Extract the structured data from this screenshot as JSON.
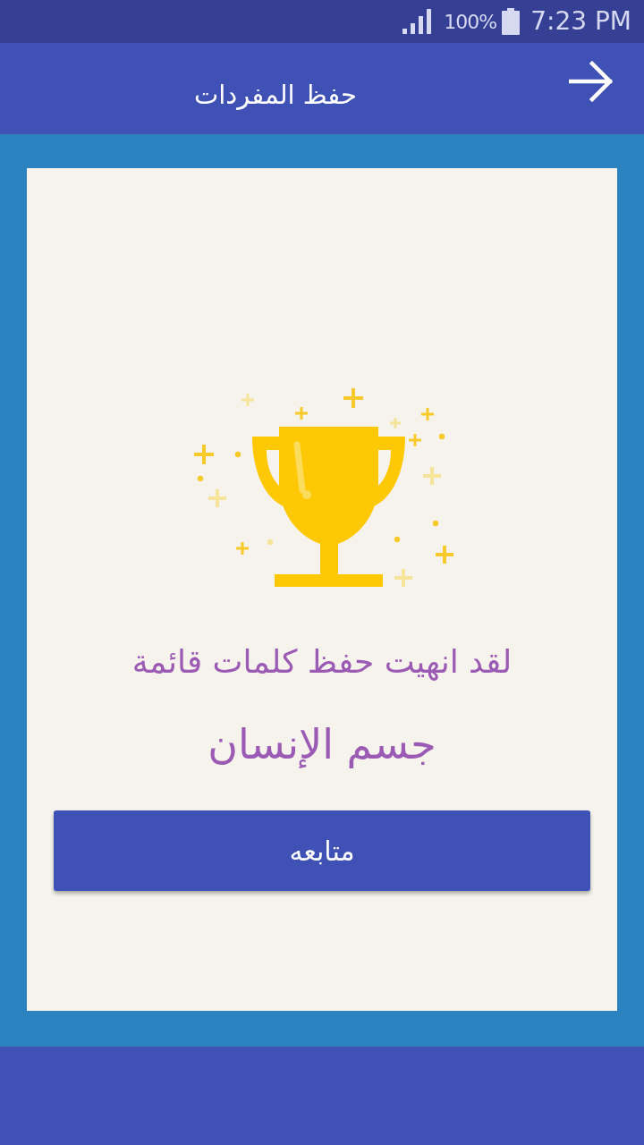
{
  "status_bar": {
    "battery_percent": "100%",
    "time": "7:23 PM"
  },
  "app_bar": {
    "title": "حفظ المفردات"
  },
  "completion": {
    "message": "لقد انهيت حفظ كلمات قائمة",
    "list_name": "جسم الإنسان"
  },
  "continue_button": {
    "label": "متابعه"
  }
}
